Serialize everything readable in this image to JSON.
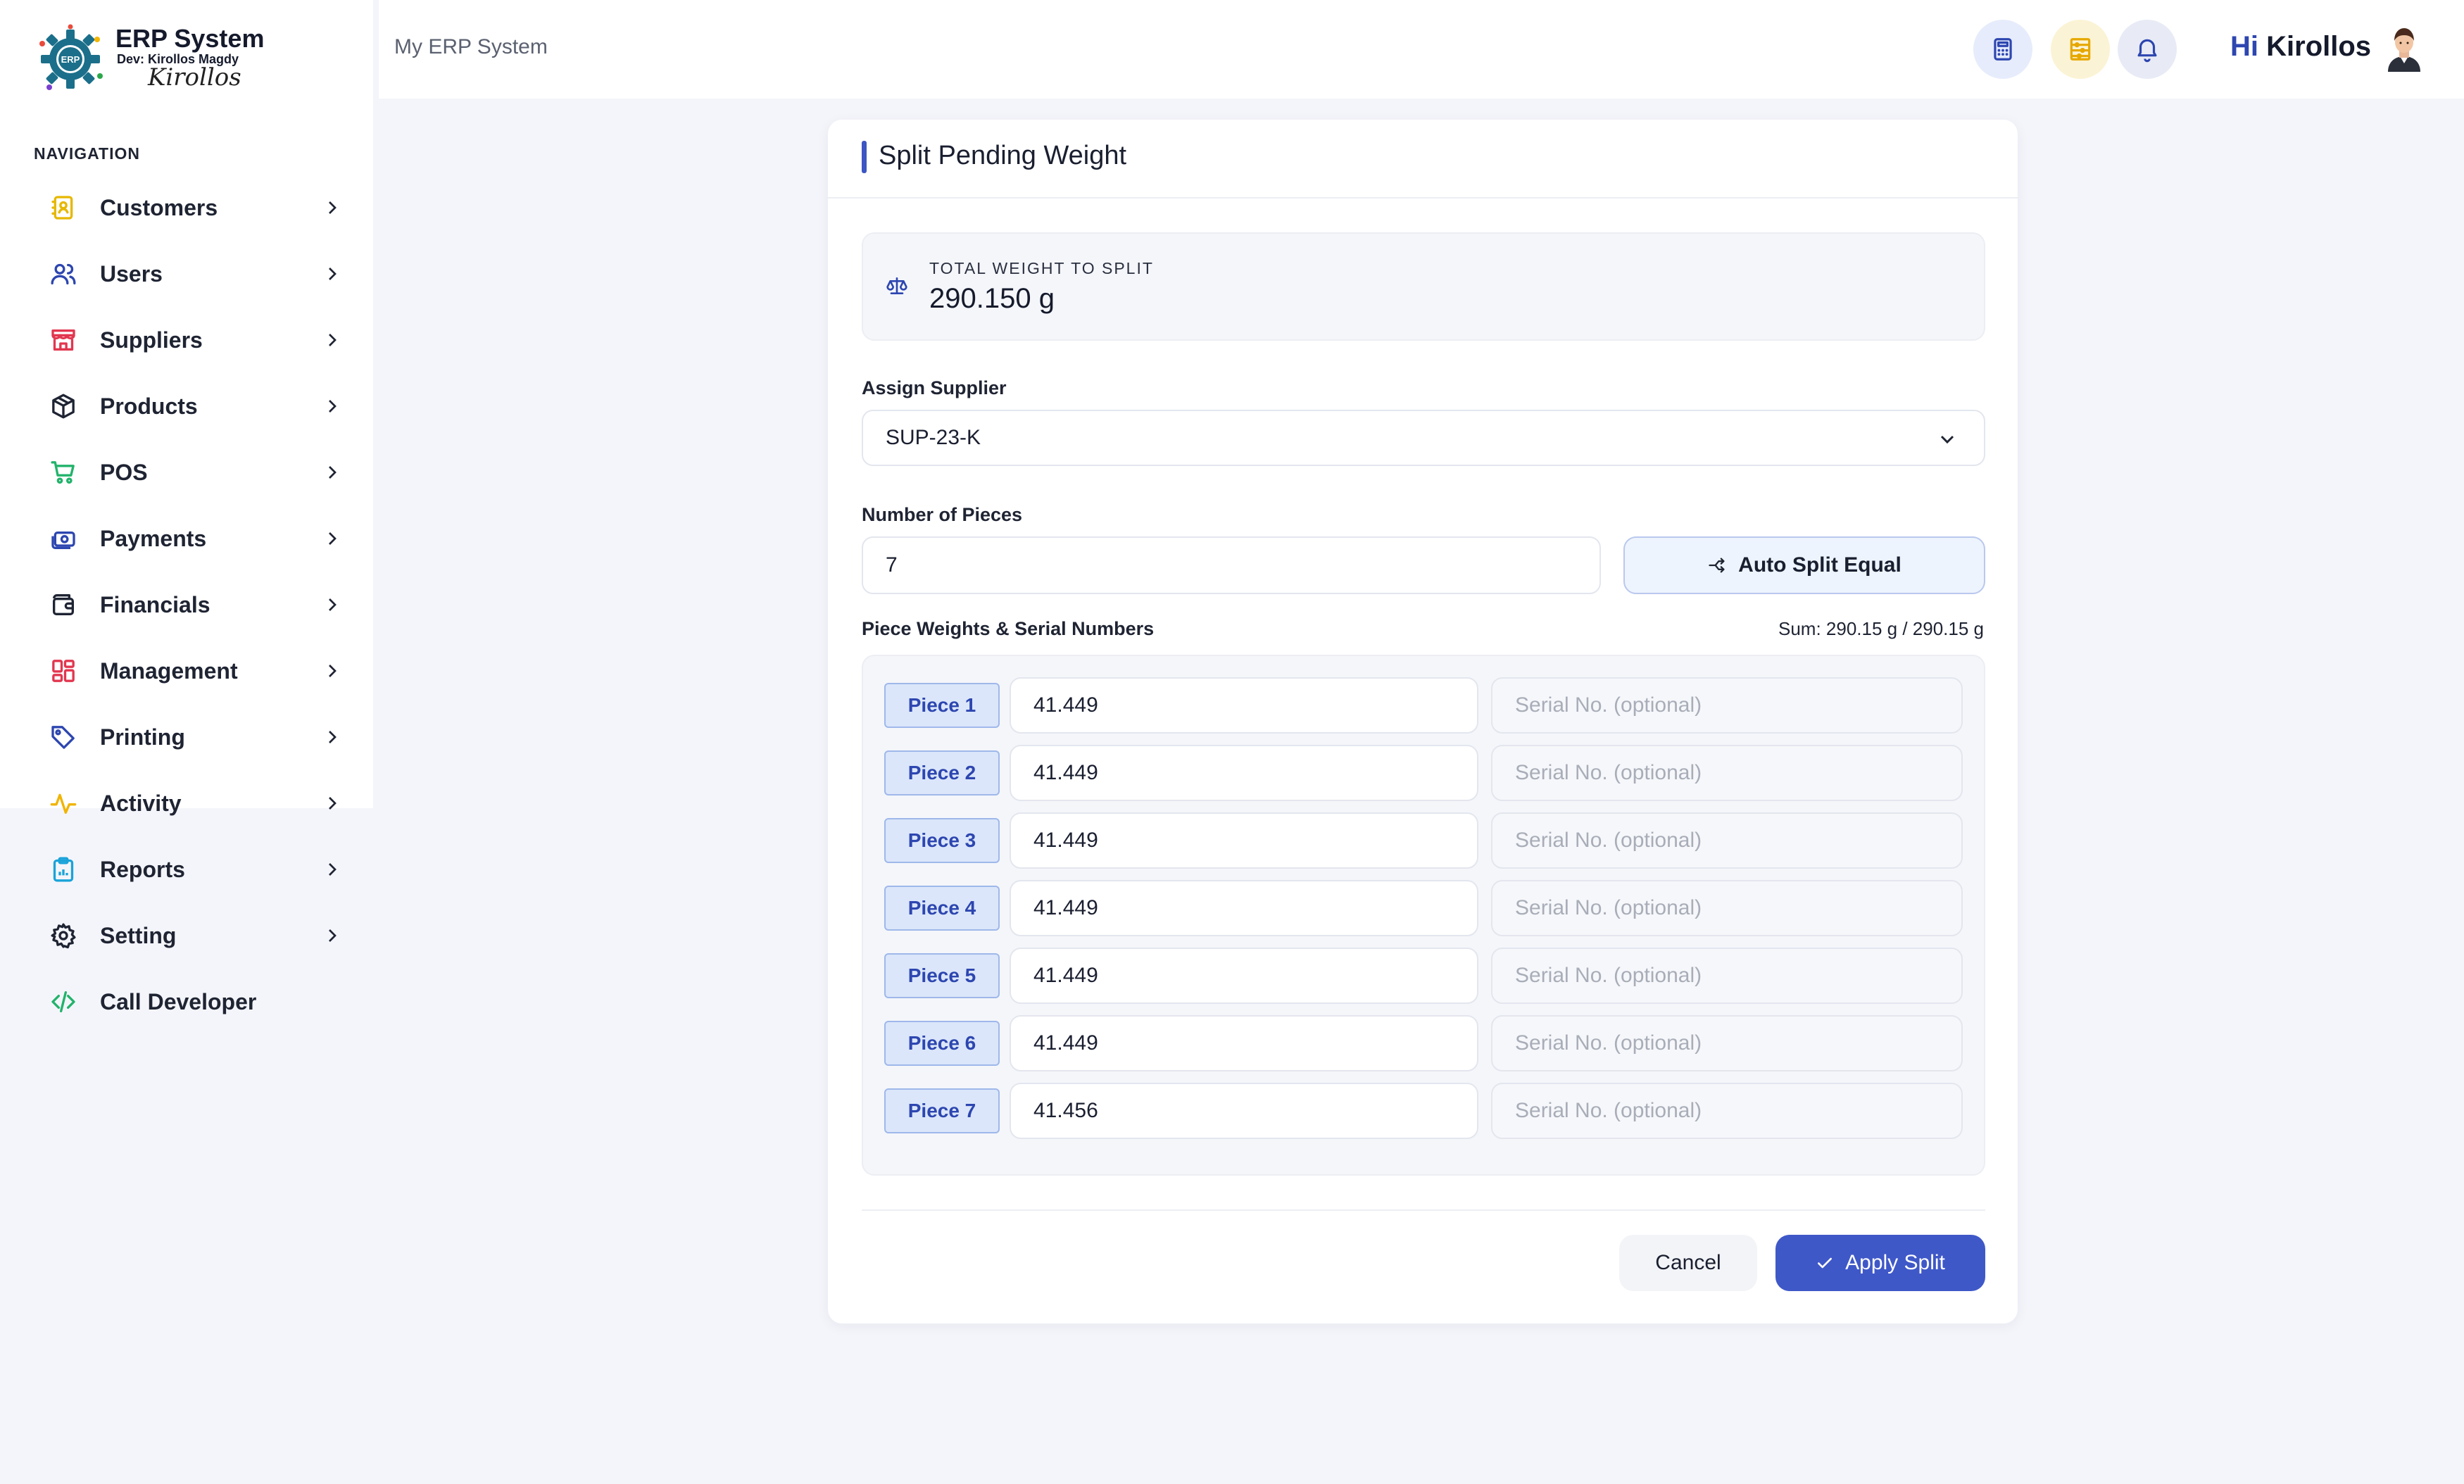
{
  "brand": {
    "title": "ERP System",
    "dev": "Dev: Kirollos Magdy",
    "signature": "Kirollos",
    "logo_text": "ERP"
  },
  "sidebar": {
    "heading": "NAVIGATION",
    "items": [
      {
        "label": "Customers",
        "icon": "contact-book-icon",
        "color": "#e6b800"
      },
      {
        "label": "Users",
        "icon": "users-icon",
        "color": "#2d46b0"
      },
      {
        "label": "Suppliers",
        "icon": "store-icon",
        "color": "#e2364f"
      },
      {
        "label": "Products",
        "icon": "box-icon",
        "color": "#1f2433"
      },
      {
        "label": "POS",
        "icon": "cart-icon",
        "color": "#22b36b"
      },
      {
        "label": "Payments",
        "icon": "money-icon",
        "color": "#2d46b0"
      },
      {
        "label": "Financials",
        "icon": "wallet-icon",
        "color": "#1f2433"
      },
      {
        "label": "Management",
        "icon": "dashboard-icon",
        "color": "#e2364f"
      },
      {
        "label": "Printing",
        "icon": "tag-icon",
        "color": "#2d46b0"
      },
      {
        "label": "Activity",
        "icon": "pulse-icon",
        "color": "#f0b400"
      },
      {
        "label": "Reports",
        "icon": "clipboard-chart-icon",
        "color": "#1aa3d9"
      },
      {
        "label": "Setting",
        "icon": "gear-icon",
        "color": "#1f2433"
      },
      {
        "label": "Call Developer",
        "icon": "code-icon",
        "color": "#22b36b"
      }
    ]
  },
  "header": {
    "breadcrumb": "My ERP System",
    "greeting_hi": "Hi",
    "greeting_name": "Kirollos",
    "icons": [
      "calculator-icon",
      "abacus-icon",
      "bell-icon"
    ]
  },
  "modal": {
    "title": "Split Pending Weight",
    "total_label": "TOTAL WEIGHT TO SPLIT",
    "total_value": "290.150 g",
    "supplier_label": "Assign Supplier",
    "supplier_value": "SUP-23-K",
    "pieces_label": "Number of Pieces",
    "pieces_value": "7",
    "auto_split_label": "Auto Split Equal",
    "pieces_section_label": "Piece Weights & Serial Numbers",
    "sum_text": "Sum: 290.15 g / 290.15 g",
    "serial_placeholder": "Serial No. (optional)",
    "pieces": [
      {
        "label": "Piece 1",
        "weight": "41.449",
        "serial": ""
      },
      {
        "label": "Piece 2",
        "weight": "41.449",
        "serial": ""
      },
      {
        "label": "Piece 3",
        "weight": "41.449",
        "serial": ""
      },
      {
        "label": "Piece 4",
        "weight": "41.449",
        "serial": ""
      },
      {
        "label": "Piece 5",
        "weight": "41.449",
        "serial": ""
      },
      {
        "label": "Piece 6",
        "weight": "41.449",
        "serial": ""
      },
      {
        "label": "Piece 7",
        "weight": "41.456",
        "serial": ""
      }
    ],
    "cancel_label": "Cancel",
    "apply_label": "Apply Split"
  },
  "colors": {
    "accent": "#3f58c8",
    "piece_tag_bg": "#dbe6fa",
    "background": "#f4f5fa"
  }
}
